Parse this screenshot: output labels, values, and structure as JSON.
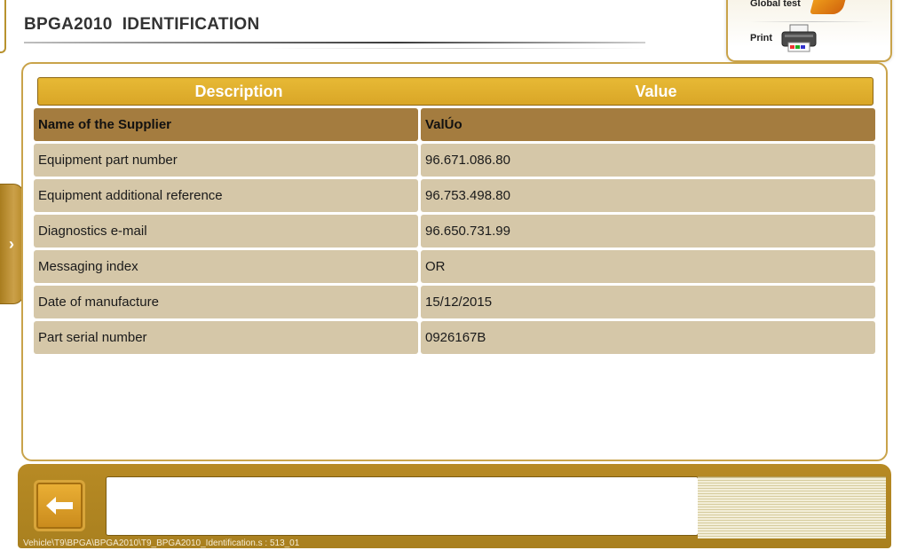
{
  "header": {
    "title": "BPGA2010  IDENTIFICATION"
  },
  "actions": {
    "global_test_label": "Global test",
    "print_label": "Print"
  },
  "side_tab": {
    "glyph": "›"
  },
  "table": {
    "headers": {
      "description": "Description",
      "value": "Value"
    },
    "supplier_row": {
      "description": "Name of the Supplier",
      "value": "ValÚo"
    },
    "rows": [
      {
        "description": "Equipment part number",
        "value": "96.671.086.80"
      },
      {
        "description": "Equipment additional reference",
        "value": "96.753.498.80"
      },
      {
        "description": "Diagnostics e-mail",
        "value": "96.650.731.99"
      },
      {
        "description": "Messaging index",
        "value": "OR"
      },
      {
        "description": "Date of manufacture",
        "value": "15/12/2015"
      },
      {
        "description": "Part serial number",
        "value": "0926167B"
      }
    ]
  },
  "bottom": {
    "message": "",
    "status_path": "Vehicle\\T9\\BPGA\\BPGA2010\\T9_BPGA2010_Identification.s : 513_01"
  },
  "colors": {
    "accent": "#e2b22f",
    "frame": "#c9a34a",
    "bar": "#b18624",
    "header_row": "#a47c3f",
    "data_row": "#d5c7a8"
  },
  "icons": {
    "global_test": "global-test-icon",
    "print": "printer-icon",
    "back": "back-arrow-icon",
    "side_tab": "chevron-right-icon"
  }
}
